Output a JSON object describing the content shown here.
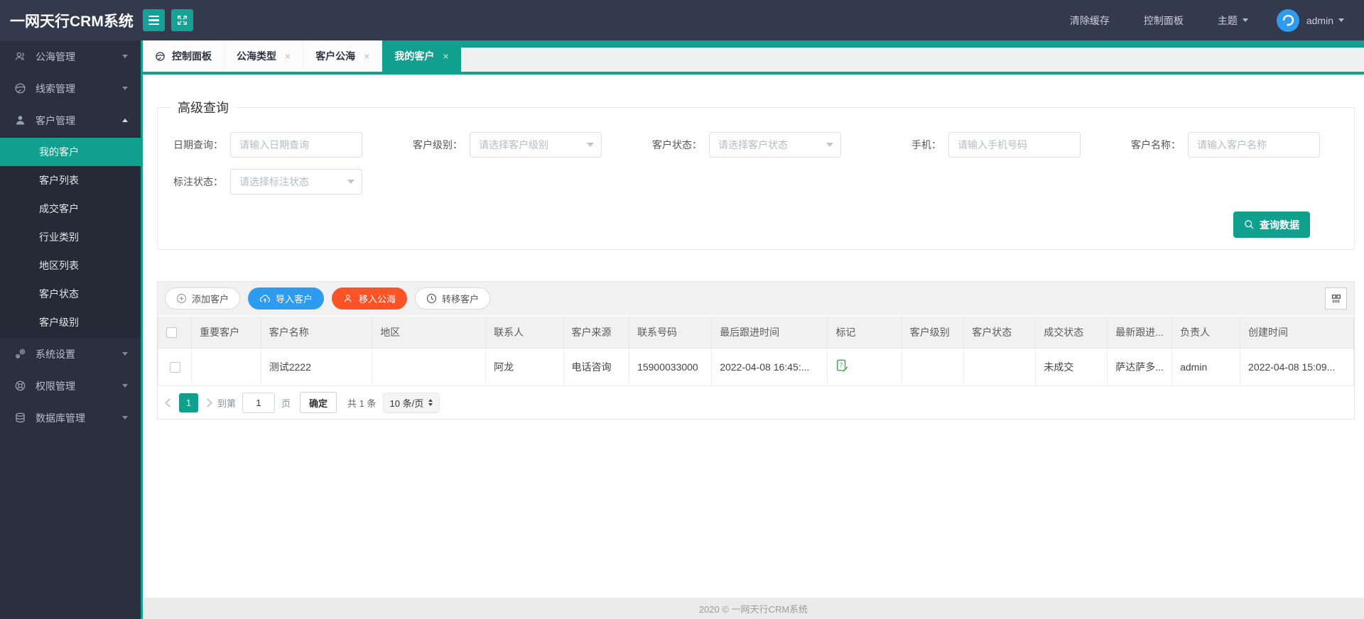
{
  "glyphs": {
    "close": "×"
  },
  "header": {
    "logo": "一网天行CRM系统",
    "clear_cache": "清除缓存",
    "dashboard": "控制面板",
    "theme": "主题",
    "username": "admin"
  },
  "sidebar": {
    "items": [
      {
        "label": "公海管理",
        "icon": "users-icon"
      },
      {
        "label": "线索管理",
        "icon": "globe-icon"
      },
      {
        "label": "客户管理",
        "icon": "user-icon",
        "expanded": true,
        "children": [
          {
            "label": "我的客户",
            "active": true
          },
          {
            "label": "客户列表"
          },
          {
            "label": "成交客户"
          },
          {
            "label": "行业类别"
          },
          {
            "label": "地区列表"
          },
          {
            "label": "客户状态"
          },
          {
            "label": "客户级别"
          }
        ]
      },
      {
        "label": "系统设置",
        "icon": "settings-icon"
      },
      {
        "label": "权限管理",
        "icon": "permissions-icon"
      },
      {
        "label": "数据库管理",
        "icon": "database-icon"
      }
    ]
  },
  "tabs": [
    {
      "label": "控制面板",
      "icon": "globe-icon",
      "closable": false
    },
    {
      "label": "公海类型",
      "closable": true
    },
    {
      "label": "客户公海",
      "closable": true
    },
    {
      "label": "我的客户",
      "closable": true,
      "active": true
    }
  ],
  "query": {
    "legend": "高级查询",
    "fields": [
      {
        "label": "日期查询：",
        "placeholder": "请输入日期查询",
        "type": "input"
      },
      {
        "label": "客户级别：",
        "placeholder": "请选择客户级别",
        "type": "select"
      },
      {
        "label": "客户状态：",
        "placeholder": "请选择客户状态",
        "type": "select"
      },
      {
        "label": "手机：",
        "placeholder": "请输入手机号码",
        "type": "input"
      },
      {
        "label": "客户名称：",
        "placeholder": "请输入客户名称",
        "type": "input"
      },
      {
        "label": "标注状态：",
        "placeholder": "请选择标注状态",
        "type": "select"
      }
    ],
    "search_button": "查询数据"
  },
  "toolbar": {
    "add": "添加客户",
    "import": "导入客户",
    "move": "移入公海",
    "transfer": "转移客户"
  },
  "table": {
    "headers": [
      "重要客户",
      "客户名称",
      "地区",
      "联系人",
      "客户来源",
      "联系号码",
      "最后跟进时间",
      "标记",
      "客户级别",
      "客户状态",
      "成交状态",
      "最新跟进...",
      "负责人",
      "创建时间"
    ],
    "rows": [
      {
        "important": "",
        "name": "测试2222",
        "region": "",
        "contact": "阿龙",
        "source": "电话咨询",
        "phone": "15900033000",
        "last_follow": "2022-04-08 16:45:...",
        "mark_icon": "note-edit-icon",
        "level": "",
        "status": "",
        "deal_status": "未成交",
        "latest_follow": "萨达萨多...",
        "owner": "admin",
        "created": "2022-04-08 15:09..."
      }
    ]
  },
  "pagination": {
    "current_page": "1",
    "goto_prefix": "到第",
    "goto_value": "1",
    "goto_suffix": "页",
    "confirm": "确定",
    "total": "共 1 条",
    "page_size": "10 条/页"
  },
  "footer": {
    "copyright": "2020 ©   一网天行CRM系统"
  },
  "colors": {
    "accent": "#12A08E",
    "header_bg": "#333A4D",
    "sidebar_bg": "#2B303E",
    "blue_button": "#2D9BF0",
    "red_button": "#FF5226"
  }
}
